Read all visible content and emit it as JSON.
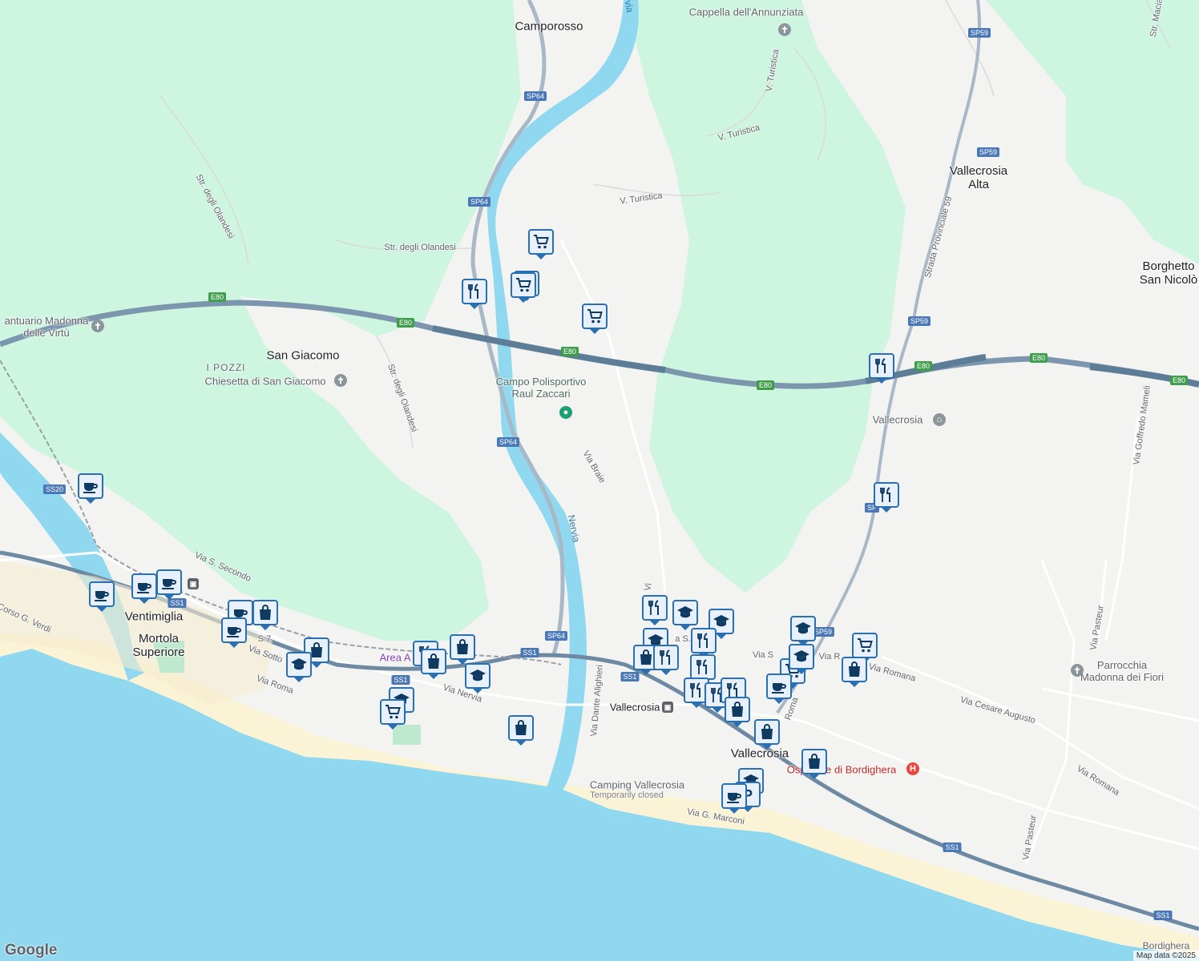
{
  "labels": {
    "camporosso": "Camporosso",
    "cappella": "Cappella dell'Annunziata",
    "vallecrosia_alta": "Vallecrosia\nAlta",
    "borghetto": "Borghetto\nSan Nicolò",
    "santuario": "antuario Madonna\ndelle Virtù",
    "i_pozzi": "I POZZI",
    "san_giacomo": "San Giacomo",
    "chiesetta": "Chiesetta di San Giacomo",
    "campo": "Campo Polisportivo\nRaul Zaccari",
    "vallecrosia_school": "Vallecrosia",
    "ventimiglia": "Ventimiglia",
    "mortola": "Mortola\nSuperiore",
    "area": "Area A",
    "vallecrosia_station": "Vallecrosia",
    "vallecrosia_town": "Vallecrosia",
    "camping": "Camping Vallecrosia",
    "camping_status": "Temporarily closed",
    "ospedale": "Ospedale di Bordighera",
    "parrocchia": "Parrocchia\nMadonna dei Fiori",
    "bordighera": "Bordighera"
  },
  "streets": {
    "olandesi1": "Str. degli Olandesi",
    "olandesi2": "Str. degli Olandesi",
    "olandesi3": "Str. degli Olandesi",
    "turistica1": "V. Turistica",
    "turistica2": "V. Turistica",
    "turistica3": "V. Turistica",
    "braie": "Via Braie",
    "sp59": "Strada Provinciale 59",
    "goffredo": "Via Goffredo Mameli",
    "pasteur1": "Via Pasteur",
    "pasteur2": "Via Pasteur",
    "secondo": "Via S. Secondo",
    "corso": "Corso G. Verdi",
    "sotto": "Via Sotto",
    "roma_w": "Via Roma",
    "nervia_st": "Via Nervia",
    "dante": "Via Dante Alighieri",
    "romana1": "Via Romana",
    "romana2": "Via Romana",
    "cesare": "Via Cesare Augusto",
    "marconi": "Via G. Marconi",
    "roma_e": "Roma",
    "vi": "Vi",
    "via_s": "Via S",
    "via_r": "Via R",
    "a_s": "a S.",
    "s7": "S 7",
    "macia": "Str. Macia"
  },
  "rivers": {
    "nervia": "Nervia",
    "nervia_top": "via"
  },
  "shields": {
    "sp64a": "SP64",
    "sp64b": "SP64",
    "sp64c": "SP64",
    "sp64d": "SP64",
    "sp59a": "SP59",
    "sp59b": "SP59",
    "sp59c": "SP59",
    "sp59d": "SP59",
    "sp59e": "SP",
    "e80a": "E80",
    "e80b": "E80",
    "e80c": "E80",
    "e80d": "E80",
    "e80e": "E80",
    "e80f": "E80",
    "e80g": "E80",
    "ss20": "SS20",
    "ss1a": "SS1",
    "ss1b": "SS1",
    "ss1c": "SS1",
    "ss1d": "SS1",
    "ss1e": "SS1"
  },
  "markers": [
    "shopping-cart-icon",
    "shopping-cart-icon",
    "shopping-cart-icon",
    "restaurant-icon",
    "shopping-cart-icon",
    "restaurant-icon",
    "restaurant-icon",
    "cafe-icon",
    "cafe-icon",
    "cafe-icon",
    "cafe-icon",
    "shopping-bag-icon",
    "cafe-icon",
    "cafe-icon",
    "shopping-bag-icon",
    "school-icon",
    "restaurant-icon",
    "shopping-bag-icon",
    "shopping-bag-icon",
    "school-icon",
    "school-icon",
    "shopping-cart-icon",
    "shopping-bag-icon",
    "restaurant-icon",
    "school-icon",
    "school-icon",
    "school-icon",
    "restaurant-icon",
    "shopping-bag-icon",
    "restaurant-icon",
    "restaurant-icon",
    "restaurant-icon",
    "school-icon",
    "shopping-cart-icon",
    "shopping-cart-icon",
    "school-icon",
    "cafe-icon",
    "restaurant-icon",
    "restaurant-icon",
    "shopping-bag-icon",
    "shopping-bag-icon",
    "shopping-bag-icon",
    "shopping-bag-icon",
    "school-icon",
    "parking-icon",
    "cafe-icon"
  ],
  "attribution": {
    "logo": "Google",
    "text": "Map data ©2025"
  },
  "colors": {
    "water": "#8fd8ef",
    "green": "#cdf5e0",
    "land": "#f3f3f1",
    "motorway": "#7b96ad",
    "marker_border": "#2a6fb2"
  }
}
